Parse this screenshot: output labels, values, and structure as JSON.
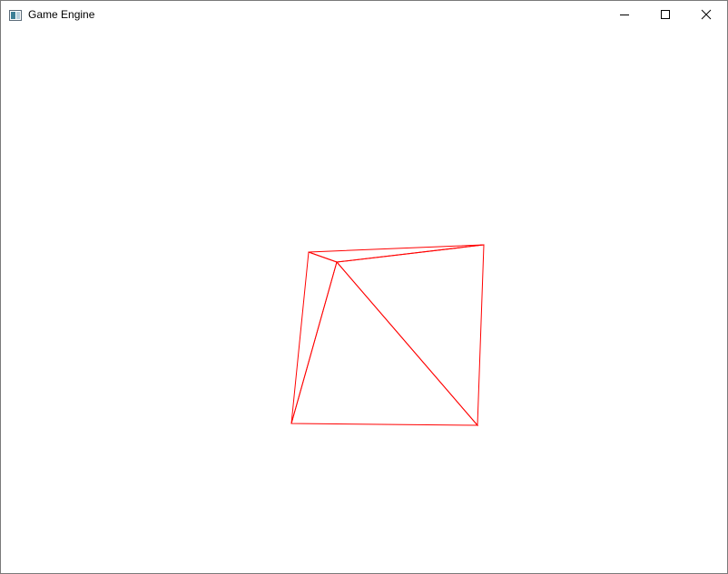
{
  "window": {
    "title": "Game Engine",
    "icon": "app-window-icon",
    "controls": [
      "minimize-icon",
      "maximize-icon",
      "close-icon"
    ]
  },
  "scene": {
    "background": "#ffffff",
    "wire_color": "#ff0000",
    "mesh": "wireframe-triangles"
  }
}
